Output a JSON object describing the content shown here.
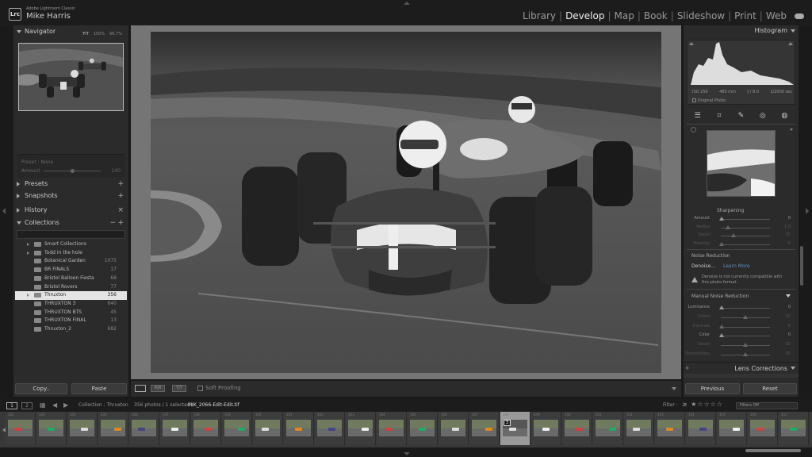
{
  "header": {
    "logo_text": "Lrc",
    "app_name": "Adobe Lightroom Classic",
    "user_name": "Mike Harris",
    "modules": [
      "Library",
      "Develop",
      "Map",
      "Book",
      "Slideshow",
      "Print",
      "Web"
    ],
    "active_module": "Develop"
  },
  "navigator": {
    "title": "Navigator",
    "zoom_options": [
      "FIT",
      "100%",
      "66.7%"
    ]
  },
  "preset_box": {
    "label": "Preset : None",
    "amount_label": "Amount",
    "amount_value": "100"
  },
  "left_panels": {
    "presets": "Presets",
    "snapshots": "Snapshots",
    "history": "History",
    "collections": "Collections",
    "plus": "+",
    "minus": "−",
    "close": "×"
  },
  "collections": [
    {
      "name": "Smart Collections",
      "count": "",
      "expandable": true,
      "selected": false
    },
    {
      "name": "Todd in the hole",
      "count": "",
      "expandable": true,
      "selected": false
    },
    {
      "name": "Botanical Garden",
      "count": "1075",
      "expandable": false,
      "selected": false
    },
    {
      "name": "BR FINALS",
      "count": "17",
      "expandable": false,
      "selected": false
    },
    {
      "name": "Bristol Balloon Fiesta",
      "count": "68",
      "expandable": false,
      "selected": false
    },
    {
      "name": "Bristol Rovers",
      "count": "77",
      "expandable": false,
      "selected": false
    },
    {
      "name": "Thruxton",
      "count": "356",
      "expandable": true,
      "selected": true
    },
    {
      "name": "THRUXTON 3",
      "count": "640",
      "expandable": false,
      "selected": false
    },
    {
      "name": "THRUXTON BTS",
      "count": "45",
      "expandable": false,
      "selected": false
    },
    {
      "name": "THRUXTON FINAL",
      "count": "13",
      "expandable": false,
      "selected": false
    },
    {
      "name": "Thruxton_2",
      "count": "682",
      "expandable": false,
      "selected": false
    }
  ],
  "left_buttons": {
    "copy": "Copy..",
    "paste": "Paste"
  },
  "toolbar": {
    "soft_proofing": "Soft Proofing",
    "compare_a": "R|R",
    "compare_b": "Y|Y"
  },
  "histogram": {
    "title": "Histogram",
    "iso": "ISO 250",
    "focal": "480 mm",
    "aperture": "ƒ / 8.0",
    "shutter": "1/2000 sec",
    "original_photo": "Original Photo"
  },
  "detail": {
    "sharpening_title": "Sharpening",
    "sharpening": [
      {
        "label": "Amount",
        "value": "0",
        "pos": 0.02,
        "dim": false
      },
      {
        "label": "Radius",
        "value": "1.0",
        "pos": 0.15,
        "dim": true
      },
      {
        "label": "Detail",
        "value": "25",
        "pos": 0.25,
        "dim": true
      },
      {
        "label": "Masking",
        "value": "0",
        "pos": 0.02,
        "dim": true
      }
    ],
    "noise_title": "Noise Reduction",
    "denoise_label": "Denoise...",
    "learn_more": "Learn More",
    "denoise_warning": "Denoise is not currently compatible with this photo format.",
    "manual_title": "Manual Noise Reduction",
    "manual": [
      {
        "label": "Luminance",
        "value": "0",
        "pos": 0.02,
        "dim": false
      },
      {
        "label": "Detail",
        "value": "50",
        "pos": 0.5,
        "dim": true
      },
      {
        "label": "Contrast",
        "value": "0",
        "pos": 0.02,
        "dim": true
      },
      {
        "label": "Color",
        "value": "0",
        "pos": 0.02,
        "dim": false
      },
      {
        "label": "Detail",
        "value": "50",
        "pos": 0.5,
        "dim": true
      },
      {
        "label": "Smoothness",
        "value": "50",
        "pos": 0.5,
        "dim": true
      }
    ],
    "lens_corrections": "Lens Corrections"
  },
  "right_buttons": {
    "previous": "Previous",
    "reset": "Reset"
  },
  "filmstrip": {
    "page_1": "1",
    "page_2": "2",
    "collection_label": "Collection : Thruxton",
    "photo_count": "356 photos / 1 selected /",
    "filename": "MIK_2066-Edit-Edit.tif",
    "filter_label": "Filter :",
    "filter_value": "Filters Off",
    "thumbnails": [
      {
        "num": "332"
      },
      {
        "num": "333"
      },
      {
        "num": "334"
      },
      {
        "num": "335"
      },
      {
        "num": "336"
      },
      {
        "num": "337"
      },
      {
        "num": "338"
      },
      {
        "num": "339"
      },
      {
        "num": "340"
      },
      {
        "num": "341"
      },
      {
        "num": "342"
      },
      {
        "num": "343"
      },
      {
        "num": "344"
      },
      {
        "num": "345"
      },
      {
        "num": "346"
      },
      {
        "num": "347"
      },
      {
        "num": "348",
        "selected": true,
        "badge": "3"
      },
      {
        "num": "349"
      },
      {
        "num": "350"
      },
      {
        "num": "351"
      },
      {
        "num": "352"
      },
      {
        "num": "353"
      },
      {
        "num": "354"
      },
      {
        "num": "355"
      },
      {
        "num": "356"
      },
      {
        "num": "357"
      }
    ]
  }
}
